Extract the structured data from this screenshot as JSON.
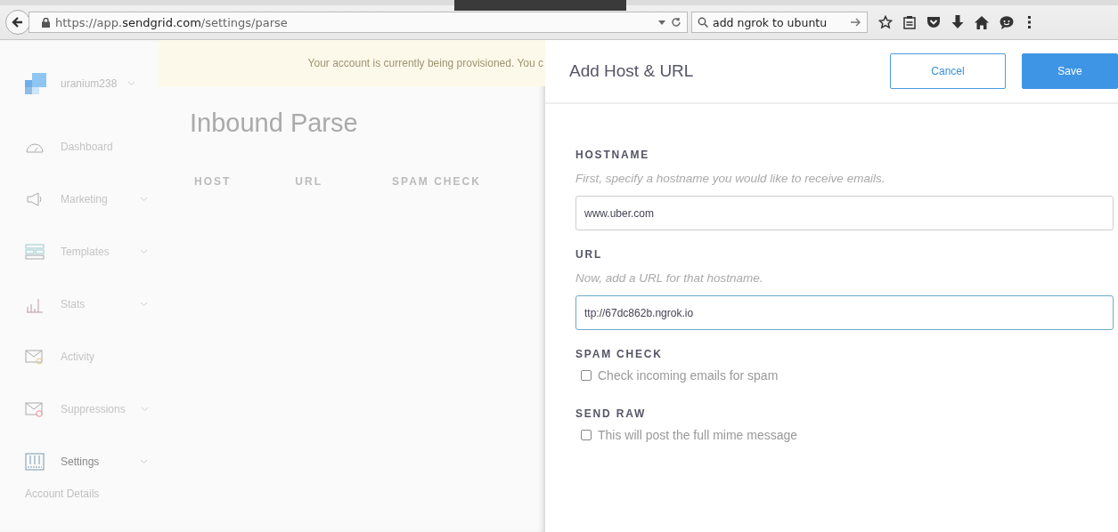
{
  "browser": {
    "url_prefix": "https://app.",
    "url_domain": "sendgrid.com",
    "url_path": "/settings/parse",
    "search": "add ngrok to ubuntu"
  },
  "account": {
    "name": "uranium238"
  },
  "banner": {
    "text": "Your account is currently being provisioned. You c"
  },
  "sidebar": {
    "items": [
      {
        "label": "Dashboard",
        "expandable": false,
        "selected": false
      },
      {
        "label": "Marketing",
        "expandable": true,
        "selected": false
      },
      {
        "label": "Templates",
        "expandable": true,
        "selected": false
      },
      {
        "label": "Stats",
        "expandable": true,
        "selected": false
      },
      {
        "label": "Activity",
        "expandable": false,
        "selected": false
      },
      {
        "label": "Suppressions",
        "expandable": true,
        "selected": false
      },
      {
        "label": "Settings",
        "expandable": true,
        "selected": true
      }
    ],
    "subitem": "Account Details"
  },
  "page": {
    "title": "Inbound Parse",
    "columns": [
      "HOST",
      "URL",
      "SPAM CHECK"
    ]
  },
  "drawer": {
    "title": "Add Host & URL",
    "buttons": [
      {
        "label": "Cancel",
        "kind": "secondary"
      },
      {
        "label": "Save",
        "kind": "primary"
      }
    ],
    "fields": [
      {
        "label": "HOSTNAME",
        "hint": "First, specify a hostname you would like to receive emails.",
        "value": "www.uber.com",
        "focused": false
      },
      {
        "label": "URL",
        "hint": "Now, add a URL for that hostname.",
        "value": "ttp://67dc862b.ngrok.io",
        "focused": true
      }
    ],
    "options": [
      {
        "label": "SPAM CHECK",
        "text": "Check incoming emails for spam",
        "checked": false
      },
      {
        "label": "SEND RAW",
        "text": "This will post the full mime message",
        "checked": false
      }
    ]
  }
}
